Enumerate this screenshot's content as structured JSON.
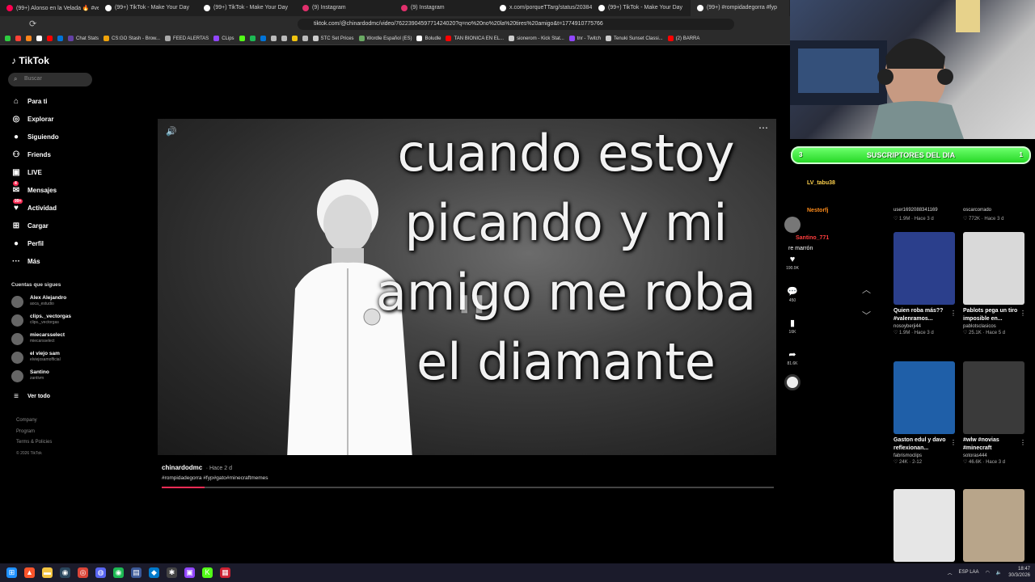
{
  "browser": {
    "tabs": [
      {
        "title": "(99+) Alonso en la Velada 🔥 #velada",
        "color": "#ff0050"
      },
      {
        "title": "(99+) TikTok - Make Your Day",
        "color": "#ffffff"
      },
      {
        "title": "(99+) TikTok - Make Your Day",
        "color": "#ffffff"
      },
      {
        "title": "(9) Instagram",
        "color": "#e1306c"
      },
      {
        "title": "(9) Instagram",
        "color": "#e1306c"
      },
      {
        "title": "x.com/porqueTTarg/status/2038442",
        "color": "#ffffff"
      },
      {
        "title": "(99+) TikTok - Make Your Day",
        "color": "#ffffff"
      },
      {
        "title": "(99+) #rompidadegorra #fyp",
        "color": "#ffffff"
      }
    ],
    "url": "tiktok.com/@chinardodmc/video/7622390459771424020?q=no%20no%20la%20tires%20amigo&t=1774910775766",
    "bookmarks": [
      {
        "label": "",
        "color": "#2ecc40"
      },
      {
        "label": "",
        "color": "#ff4136"
      },
      {
        "label": "",
        "color": "#ff851b"
      },
      {
        "label": "",
        "color": "#ffffff"
      },
      {
        "label": "",
        "color": "#ff0000"
      },
      {
        "label": "",
        "color": "#0074d9"
      },
      {
        "label": "Chat Stats",
        "color": "#6441a5"
      },
      {
        "label": "CS:GO Stash - Brow...",
        "color": "#f0a30a"
      },
      {
        "label": "FEED ALERTAS",
        "color": "#aaaaaa"
      },
      {
        "label": "CLips",
        "color": "#9146ff"
      },
      {
        "label": "",
        "color": "#53fc18"
      },
      {
        "label": "",
        "color": "#1db954"
      },
      {
        "label": "",
        "color": "#0074d9"
      },
      {
        "label": "",
        "color": "#bbbbbb"
      },
      {
        "label": "",
        "color": "#bbbbbb"
      },
      {
        "label": "",
        "color": "#f1c40f"
      },
      {
        "label": "",
        "color": "#bbbbbb"
      },
      {
        "label": "STC Set Prices",
        "color": "#cccccc"
      },
      {
        "label": "Wordle Español (ES)",
        "color": "#6aaa64"
      },
      {
        "label": "Boludle",
        "color": "#ffffff"
      },
      {
        "label": "TAN BIONICA EN EL...",
        "color": "#ff0000"
      },
      {
        "label": "sionerom - Kick Stat...",
        "color": "#cccccc"
      },
      {
        "label": "tnr - Twitch",
        "color": "#9146ff"
      },
      {
        "label": "Tenuki Sunset Classi...",
        "color": "#cccccc"
      },
      {
        "label": "(2) BARRA",
        "color": "#ff0000"
      }
    ]
  },
  "tiktok": {
    "logo": "TikTok",
    "search_placeholder": "Buscar",
    "nav": [
      {
        "label": "Para ti",
        "icon": "home-icon",
        "glyph": "⌂"
      },
      {
        "label": "Explorar",
        "icon": "compass-icon",
        "glyph": "◎"
      },
      {
        "label": "Siguiendo",
        "icon": "following-icon",
        "glyph": "●"
      },
      {
        "label": "Friends",
        "icon": "friends-icon",
        "glyph": "⚇"
      },
      {
        "label": "LIVE",
        "icon": "live-icon",
        "glyph": "▣"
      },
      {
        "label": "Mensajes",
        "icon": "messages-icon",
        "glyph": "✉",
        "badge": "4"
      },
      {
        "label": "Actividad",
        "icon": "activity-icon",
        "glyph": "♥",
        "badge": "99+"
      },
      {
        "label": "Cargar",
        "icon": "upload-icon",
        "glyph": "⊞"
      },
      {
        "label": "Perfil",
        "icon": "profile-icon",
        "glyph": "●"
      },
      {
        "label": "Más",
        "icon": "more-icon",
        "glyph": "···"
      }
    ],
    "following_title": "Cuentas que sigues",
    "following": [
      {
        "name": "Alex Alejandro",
        "handle": "aoca_estudio"
      },
      {
        "name": "clips._vectorgas",
        "handle": "clips._vectorgas"
      },
      {
        "name": "miecarsselect",
        "handle": "miecarsselect"
      },
      {
        "name": "el viejo sam",
        "handle": "elviejosamofficial"
      },
      {
        "name": "Santino",
        "handle": "zantivm"
      }
    ],
    "see_all": "Ver todo",
    "footer": [
      "Company",
      "Program",
      "Terms & Policies",
      "© 2026 TikTok"
    ]
  },
  "video": {
    "caption": "cuando estoy picando y mi amigo me roba el diamante",
    "author": "chinardodmc",
    "time_ago": "· Hace 2 d",
    "hashtags": "#rompidadegorra #fyp#gato#minecraftmemes",
    "progress": 0.07,
    "actions": [
      {
        "icon": "heart-icon",
        "glyph": "♥",
        "count": "190.9K"
      },
      {
        "icon": "comment-icon",
        "glyph": "💬",
        "count": "450"
      },
      {
        "icon": "bookmark-icon",
        "glyph": "▮",
        "count": "16K"
      },
      {
        "icon": "share-icon",
        "glyph": "➦",
        "count": "81.6K"
      }
    ]
  },
  "stream": {
    "banner": "SUSCRIPTORES DEL DIA",
    "banner_left": "3",
    "banner_right": "1",
    "chat": [
      {
        "user": "LV_tabu38",
        "color": "#ffd24d"
      },
      {
        "user": "Nestorfj",
        "color": "#ff8c1a"
      },
      {
        "user": "Santino_771",
        "color": "#ff3d3d"
      }
    ],
    "chat_msg": "re marrón"
  },
  "related": [
    {
      "title": "Quien roba más?? #valenramos...",
      "user": "nosoyberji44",
      "likes": "♡ 1.9M",
      "date": "· Hace 3 d",
      "topuser": "user1692088341169",
      "topmeta": "♡ 1.9M · Hace 3 d",
      "thumb": "#2b3f8c",
      "col": 0,
      "row": 0
    },
    {
      "title": "Pablots pega un tiro imposible en...",
      "user": "pablotsclasicos",
      "likes": "♡ 25.1K",
      "date": "· Hace 5 d",
      "topuser": "oscarcorrado",
      "topmeta": "♡ 772K · Hace 3 d",
      "thumb": "#d9d9d9",
      "col": 1,
      "row": 0
    },
    {
      "title": "Gaston edul y davo reflexionan...",
      "user": "fabrismoclips",
      "likes": "♡ 24K",
      "date": "· 2-12",
      "thumb": "#1f5fa8",
      "col": 0,
      "row": 1
    },
    {
      "title": "#wlw #novias #minecraft",
      "user": "sotoras444",
      "likes": "♡ 46.6K",
      "date": "· Hace 3 d",
      "thumb": "#3a3a3a",
      "col": 1,
      "row": 1
    },
    {
      "title": "",
      "user": "",
      "likes": "",
      "date": "",
      "thumb": "#e6e6e6",
      "col": 0,
      "row": 2
    },
    {
      "title": "",
      "user": "",
      "likes": "",
      "date": "",
      "thumb": "#b8a58a",
      "col": 1,
      "row": 2
    }
  ],
  "taskbar": {
    "lang": "ESP LAA",
    "time": "18:47",
    "date": "30/3/2026",
    "icons": [
      {
        "name": "windows-start-icon",
        "color": "#1e90ff",
        "glyph": "⊞"
      },
      {
        "name": "brave-icon",
        "color": "#fb542b",
        "glyph": "▲"
      },
      {
        "name": "explorer-icon",
        "color": "#f4c542",
        "glyph": "▬"
      },
      {
        "name": "steam-icon",
        "color": "#2a475e",
        "glyph": "◉"
      },
      {
        "name": "chrome-icon",
        "color": "#db4437",
        "glyph": "◎"
      },
      {
        "name": "discord-icon",
        "color": "#5865f2",
        "glyph": "◍"
      },
      {
        "name": "spotify-icon",
        "color": "#1db954",
        "glyph": "◉"
      },
      {
        "name": "app-icon",
        "color": "#3b5998",
        "glyph": "▤"
      },
      {
        "name": "vscode-icon",
        "color": "#007acc",
        "glyph": "◆"
      },
      {
        "name": "app2-icon",
        "color": "#444444",
        "glyph": "✱"
      },
      {
        "name": "twitch-icon",
        "color": "#9146ff",
        "glyph": "▣"
      },
      {
        "name": "kick-icon",
        "color": "#53fc18",
        "glyph": "K"
      },
      {
        "name": "obs-icon",
        "color": "#cc2233",
        "glyph": "▦"
      }
    ]
  }
}
